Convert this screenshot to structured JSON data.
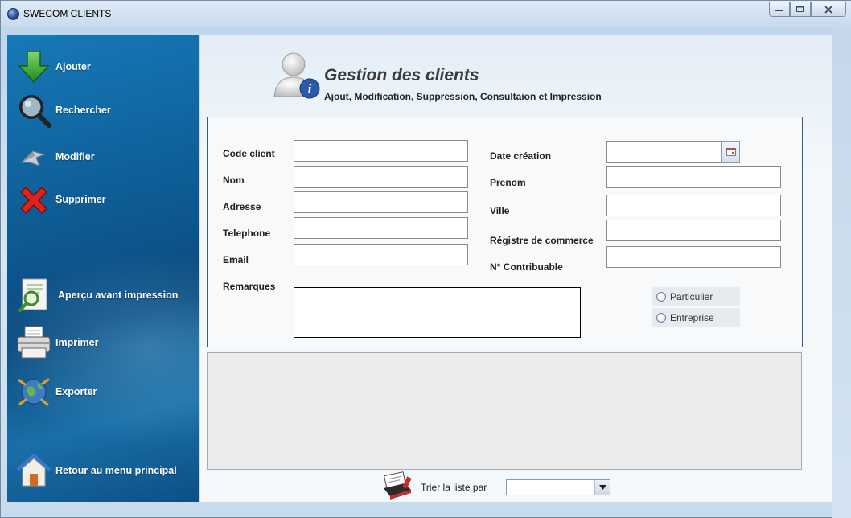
{
  "window": {
    "title": "SWECOM CLIENTS",
    "controls": {
      "minimize": "▭",
      "maximize": "□",
      "close": "✕"
    }
  },
  "sidebar": {
    "items": [
      {
        "label": "Ajouter",
        "icon": "add-arrow-icon"
      },
      {
        "label": "Rechercher",
        "icon": "magnifier-icon"
      },
      {
        "label": "Modifier",
        "icon": "edit-icon"
      },
      {
        "label": "Supprimer",
        "icon": "delete-x-icon"
      },
      {
        "label": "Aperçu avant impression",
        "icon": "print-preview-icon"
      },
      {
        "label": "Imprimer",
        "icon": "printer-icon"
      },
      {
        "label": "Exporter",
        "icon": "globe-export-icon"
      },
      {
        "label": "Retour au menu principal",
        "icon": "home-icon"
      }
    ]
  },
  "header": {
    "title": "Gestion des clients",
    "subtitle": "Ajout, Modification, Suppression, Consultaion et Impression"
  },
  "form": {
    "left_fields": [
      {
        "label": "Code client",
        "value": ""
      },
      {
        "label": "Nom",
        "value": ""
      },
      {
        "label": "Adresse",
        "value": ""
      },
      {
        "label": "Telephone",
        "value": ""
      },
      {
        "label": "Email",
        "value": ""
      }
    ],
    "remarks_label": "Remarques",
    "remarks_value": "",
    "right_fields": [
      {
        "label": "Date création",
        "value": ""
      },
      {
        "label": "Prenom",
        "value": ""
      },
      {
        "label": "Ville",
        "value": ""
      },
      {
        "label": "Régistre de commerce",
        "value": ""
      },
      {
        "label": "N° Contribuable",
        "value": ""
      }
    ],
    "client_type": {
      "options": [
        "Particulier",
        "Entreprise"
      ],
      "selected": null
    }
  },
  "sort": {
    "label": "Trier la liste par",
    "selected_value": ""
  },
  "colors": {
    "sidebar_top": "#1779b8",
    "sidebar_bottom": "#0c4f86",
    "form_border": "#2f5f85",
    "list_bg": "#ececec"
  }
}
